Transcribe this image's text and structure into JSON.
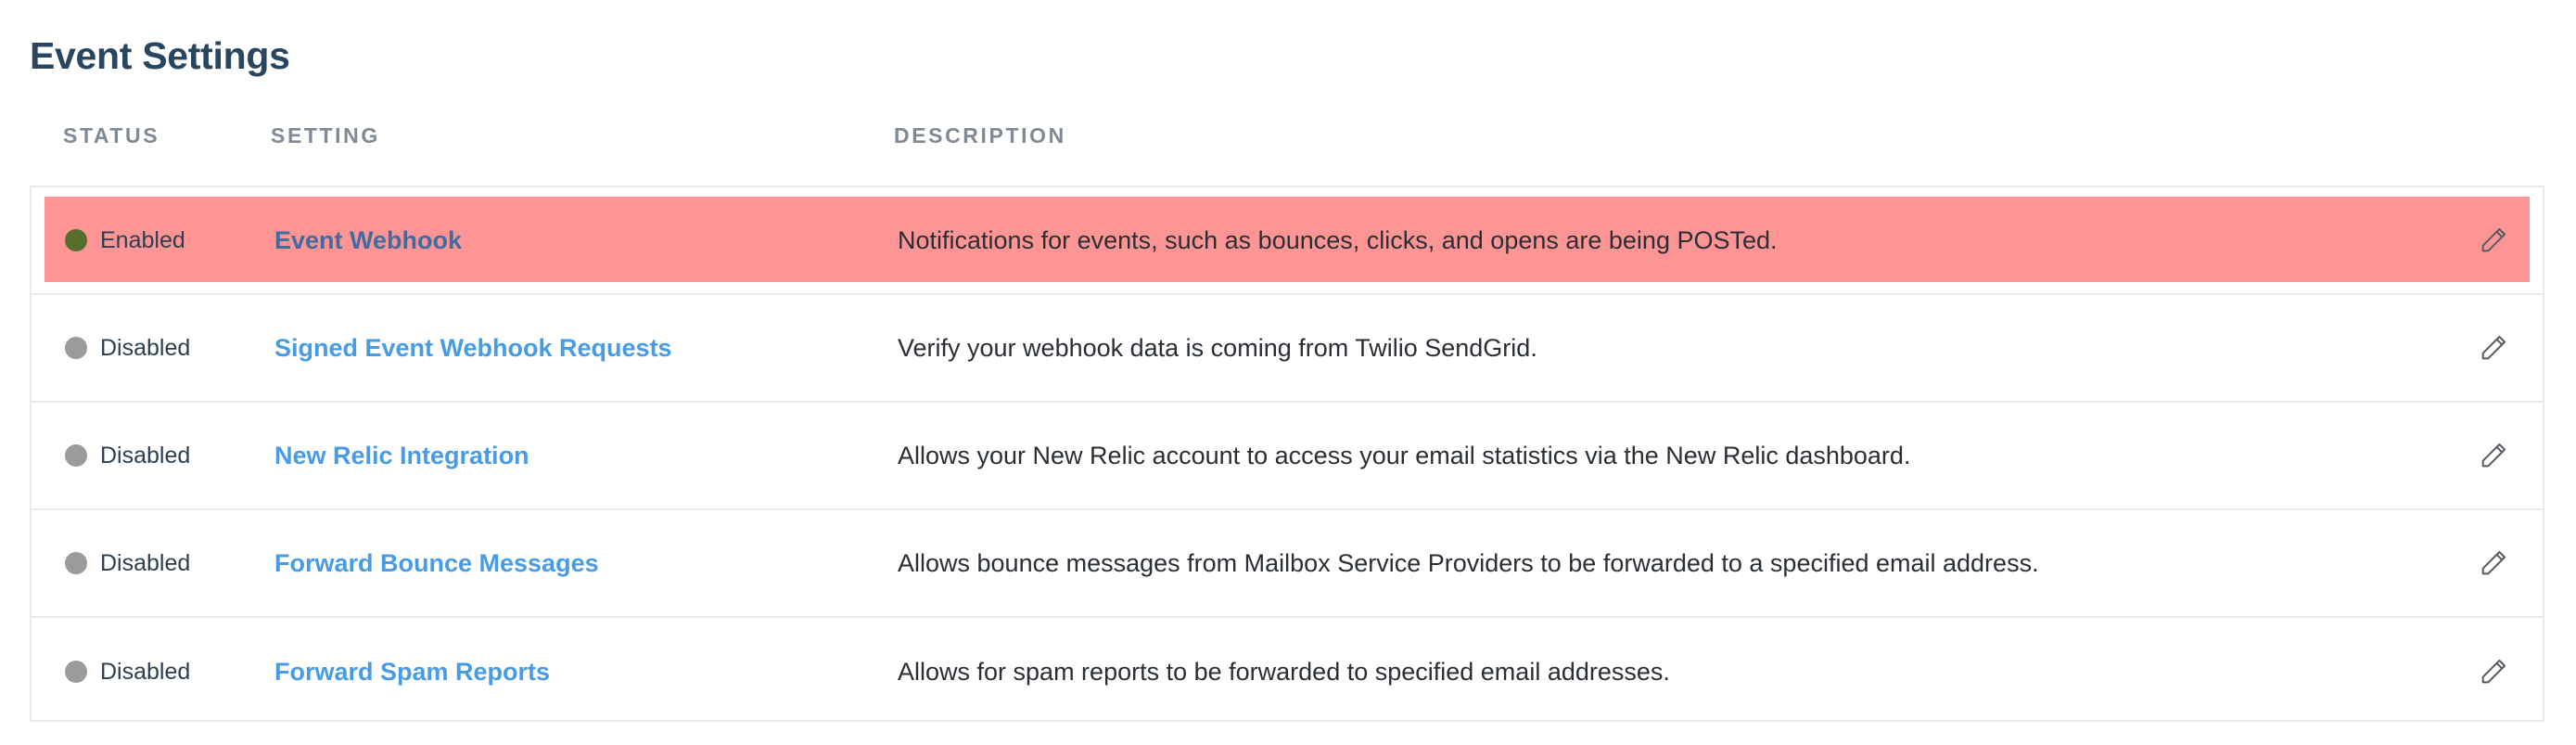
{
  "page": {
    "title": "Event Settings"
  },
  "columns": {
    "status": "STATUS",
    "setting": "SETTING",
    "description": "DESCRIPTION"
  },
  "rows": [
    {
      "status": "Enabled",
      "enabled": true,
      "setting": "Event Webhook",
      "description": "Notifications for events, such as bounces, clicks, and opens are being POSTed.",
      "highlighted": true
    },
    {
      "status": "Disabled",
      "enabled": false,
      "setting": "Signed Event Webhook Requests",
      "description": "Verify your webhook data is coming from Twilio SendGrid."
    },
    {
      "status": "Disabled",
      "enabled": false,
      "setting": "New Relic Integration",
      "description": "Allows your New Relic account to access your email statistics via the New Relic dashboard."
    },
    {
      "status": "Disabled",
      "enabled": false,
      "setting": "Forward Bounce Messages",
      "description": "Allows bounce messages from Mailbox Service Providers to be forwarded to a specified email address."
    },
    {
      "status": "Disabled",
      "enabled": false,
      "setting": "Forward Spam Reports",
      "description": "Allows for spam reports to be forwarded to specified email addresses."
    }
  ],
  "icons": {
    "edit": "pencil-icon",
    "status": "status-dot-icon"
  },
  "colors": {
    "highlight": "#fe9595",
    "enabled_dot": "#566e2c",
    "disabled_dot": "#9b9b9b",
    "link": "#489be5",
    "title": "#294661"
  }
}
